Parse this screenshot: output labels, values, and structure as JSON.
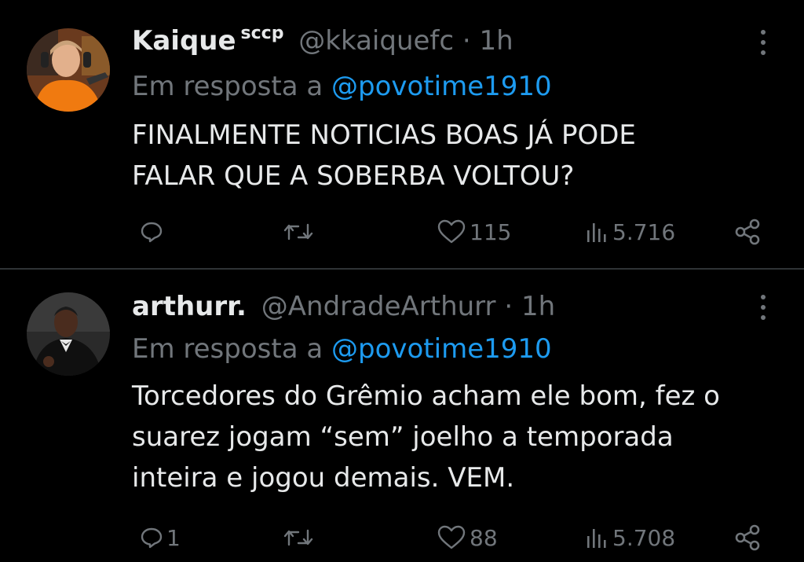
{
  "tweets": [
    {
      "name": "Kaique",
      "badge": "sccp",
      "handle": "@kkaiquefc",
      "separator": "·",
      "time": "1h",
      "reply_prefix": "Em resposta a",
      "reply_to": "@povotime1910",
      "text_lines": [
        "FINALMENTE NOTICIAS BOAS JÁ PODE",
        "FALAR QUE A SOBERBA VOLTOU?"
      ],
      "replies": "",
      "retweets": "",
      "likes": "115",
      "views": "5.716"
    },
    {
      "name": "arthurr.",
      "badge": "",
      "handle": "@AndradeArthurr",
      "separator": "·",
      "time": "1h",
      "reply_prefix": "Em resposta a",
      "reply_to": "@povotime1910",
      "text_lines": [
        "Torcedores do Grêmio acham ele bom, fez o",
        "suarez jogam “sem” joelho a temporada",
        "inteira e jogou demais. VEM."
      ],
      "replies": "1",
      "retweets": "",
      "likes": "88",
      "views": "5.708"
    }
  ],
  "colors": {
    "background": "#000000",
    "text": "#e7e9ea",
    "muted": "#71767b",
    "link": "#1d9bf0",
    "divider": "#2f3336"
  },
  "icons": [
    "reply-icon",
    "retweet-icon",
    "like-icon",
    "views-icon",
    "share-icon",
    "more-icon"
  ]
}
